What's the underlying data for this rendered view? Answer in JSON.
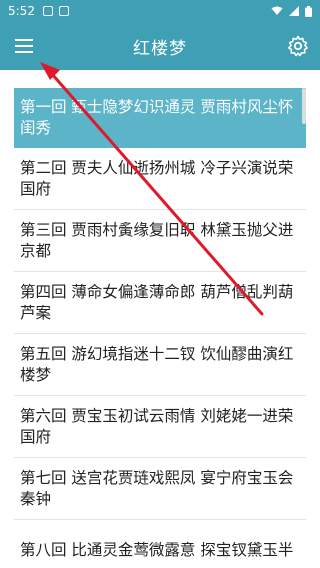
{
  "status_bar": {
    "time": "5:52",
    "icons": [
      "square-status-icon",
      "a-status-icon",
      "wifi-icon",
      "signal-icon",
      "battery-icon"
    ]
  },
  "app_bar": {
    "title": "红楼梦",
    "menu_icon": "hamburger-menu-icon",
    "settings_icon": "gear-icon"
  },
  "chapters": [
    {
      "label": "第一回 甄士隐梦幻识通灵 贾雨村风尘怀闺秀",
      "selected": true
    },
    {
      "label": "第二回 贾夫人仙逝扬州城 冷子兴演说荣国府",
      "selected": false
    },
    {
      "label": "第三回 贾雨村夤缘复旧职 林黛玉抛父进京都",
      "selected": false
    },
    {
      "label": "第四回 薄命女偏逢薄命郎 葫芦僧乱判葫芦案",
      "selected": false
    },
    {
      "label": "第五回 游幻境指迷十二钗 饮仙醪曲演红楼梦",
      "selected": false
    },
    {
      "label": "第六回 贾宝玉初试云雨情 刘姥姥一进荣国府",
      "selected": false
    },
    {
      "label": "第七回 送宫花贾琏戏熙凤 宴宁府宝玉会秦钟",
      "selected": false
    },
    {
      "label": "第八回 比通灵金莺微露意 探宝钗黛玉半",
      "selected": false
    }
  ],
  "colors": {
    "app_bar": "#3f9fb5",
    "selected_row": "#5bb4c8",
    "arrow": "#e0192a"
  }
}
